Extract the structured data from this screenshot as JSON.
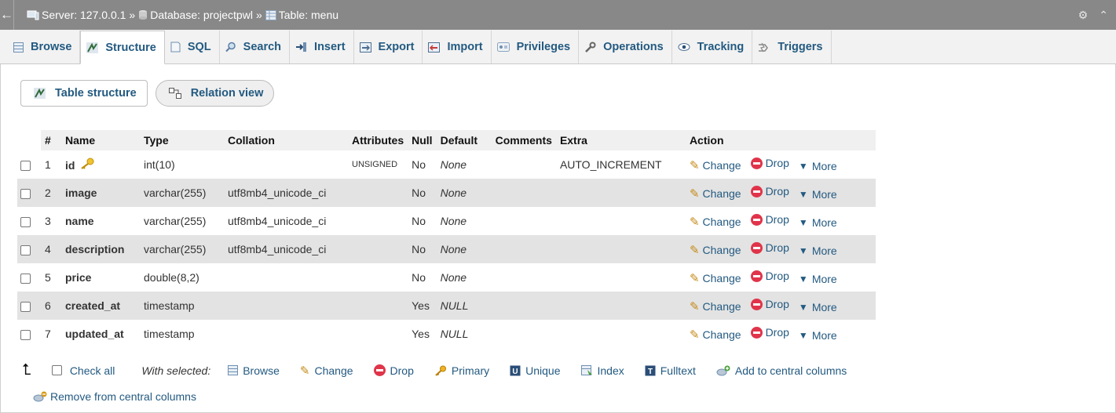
{
  "topbar": {
    "back_glyph": "←",
    "breadcrumb": [
      {
        "label": "Server: 127.0.0.1",
        "icon": "server-icon"
      },
      {
        "label": "Database: projectpwl",
        "icon": "database-icon"
      },
      {
        "label": "Table: menu",
        "icon": "table-icon"
      }
    ],
    "separator": "»",
    "settings_glyph": "⚙",
    "collapse_glyph": "⌃"
  },
  "tabs": [
    {
      "label": "Browse",
      "icon": "browse-icon",
      "active": false
    },
    {
      "label": "Structure",
      "icon": "structure-icon",
      "active": true
    },
    {
      "label": "SQL",
      "icon": "sql-icon",
      "active": false
    },
    {
      "label": "Search",
      "icon": "search-icon",
      "active": false
    },
    {
      "label": "Insert",
      "icon": "insert-icon",
      "active": false
    },
    {
      "label": "Export",
      "icon": "export-icon",
      "active": false
    },
    {
      "label": "Import",
      "icon": "import-icon",
      "active": false
    },
    {
      "label": "Privileges",
      "icon": "privileges-icon",
      "active": false
    },
    {
      "label": "Operations",
      "icon": "wrench-icon",
      "active": false
    },
    {
      "label": "Tracking",
      "icon": "eye-icon",
      "active": false
    },
    {
      "label": "Triggers",
      "icon": "triggers-icon",
      "active": false
    }
  ],
  "subtabs": {
    "table_structure": "Table structure",
    "relation_view": "Relation view"
  },
  "table": {
    "headers": [
      "#",
      "Name",
      "Type",
      "Collation",
      "Attributes",
      "Null",
      "Default",
      "Comments",
      "Extra",
      "Action"
    ],
    "rows": [
      {
        "num": "1",
        "name": "id",
        "primary": true,
        "type": "int(10)",
        "collation": "",
        "attributes": "UNSIGNED",
        "null": "No",
        "default": "None",
        "comments": "",
        "extra": "AUTO_INCREMENT"
      },
      {
        "num": "2",
        "name": "image",
        "primary": false,
        "type": "varchar(255)",
        "collation": "utf8mb4_unicode_ci",
        "attributes": "",
        "null": "No",
        "default": "None",
        "comments": "",
        "extra": ""
      },
      {
        "num": "3",
        "name": "name",
        "primary": false,
        "type": "varchar(255)",
        "collation": "utf8mb4_unicode_ci",
        "attributes": "",
        "null": "No",
        "default": "None",
        "comments": "",
        "extra": ""
      },
      {
        "num": "4",
        "name": "description",
        "primary": false,
        "type": "varchar(255)",
        "collation": "utf8mb4_unicode_ci",
        "attributes": "",
        "null": "No",
        "default": "None",
        "comments": "",
        "extra": ""
      },
      {
        "num": "5",
        "name": "price",
        "primary": false,
        "type": "double(8,2)",
        "collation": "",
        "attributes": "",
        "null": "No",
        "default": "None",
        "comments": "",
        "extra": ""
      },
      {
        "num": "6",
        "name": "created_at",
        "primary": false,
        "type": "timestamp",
        "collation": "",
        "attributes": "",
        "null": "Yes",
        "default": "NULL",
        "comments": "",
        "extra": ""
      },
      {
        "num": "7",
        "name": "updated_at",
        "primary": false,
        "type": "timestamp",
        "collation": "",
        "attributes": "",
        "null": "Yes",
        "default": "NULL",
        "comments": "",
        "extra": ""
      }
    ],
    "actions": {
      "change": "Change",
      "drop": "Drop",
      "more": "More"
    }
  },
  "footer": {
    "check_all": "Check all",
    "with_selected": "With selected:",
    "items": [
      {
        "label": "Browse",
        "icon": "browse-icon"
      },
      {
        "label": "Change",
        "icon": "pencil-icon"
      },
      {
        "label": "Drop",
        "icon": "drop-icon"
      },
      {
        "label": "Primary",
        "icon": "key-icon"
      },
      {
        "label": "Unique",
        "icon": "unique-icon"
      },
      {
        "label": "Index",
        "icon": "index-icon"
      },
      {
        "label": "Fulltext",
        "icon": "fulltext-icon"
      },
      {
        "label": "Add to central columns",
        "icon": "central-columns-add-icon"
      }
    ],
    "remove_central": "Remove from central columns"
  },
  "colors": {
    "link": "#235a81",
    "topbar": "#888888",
    "row_alt": "#e3e3e3",
    "drop": "#e0344a"
  }
}
